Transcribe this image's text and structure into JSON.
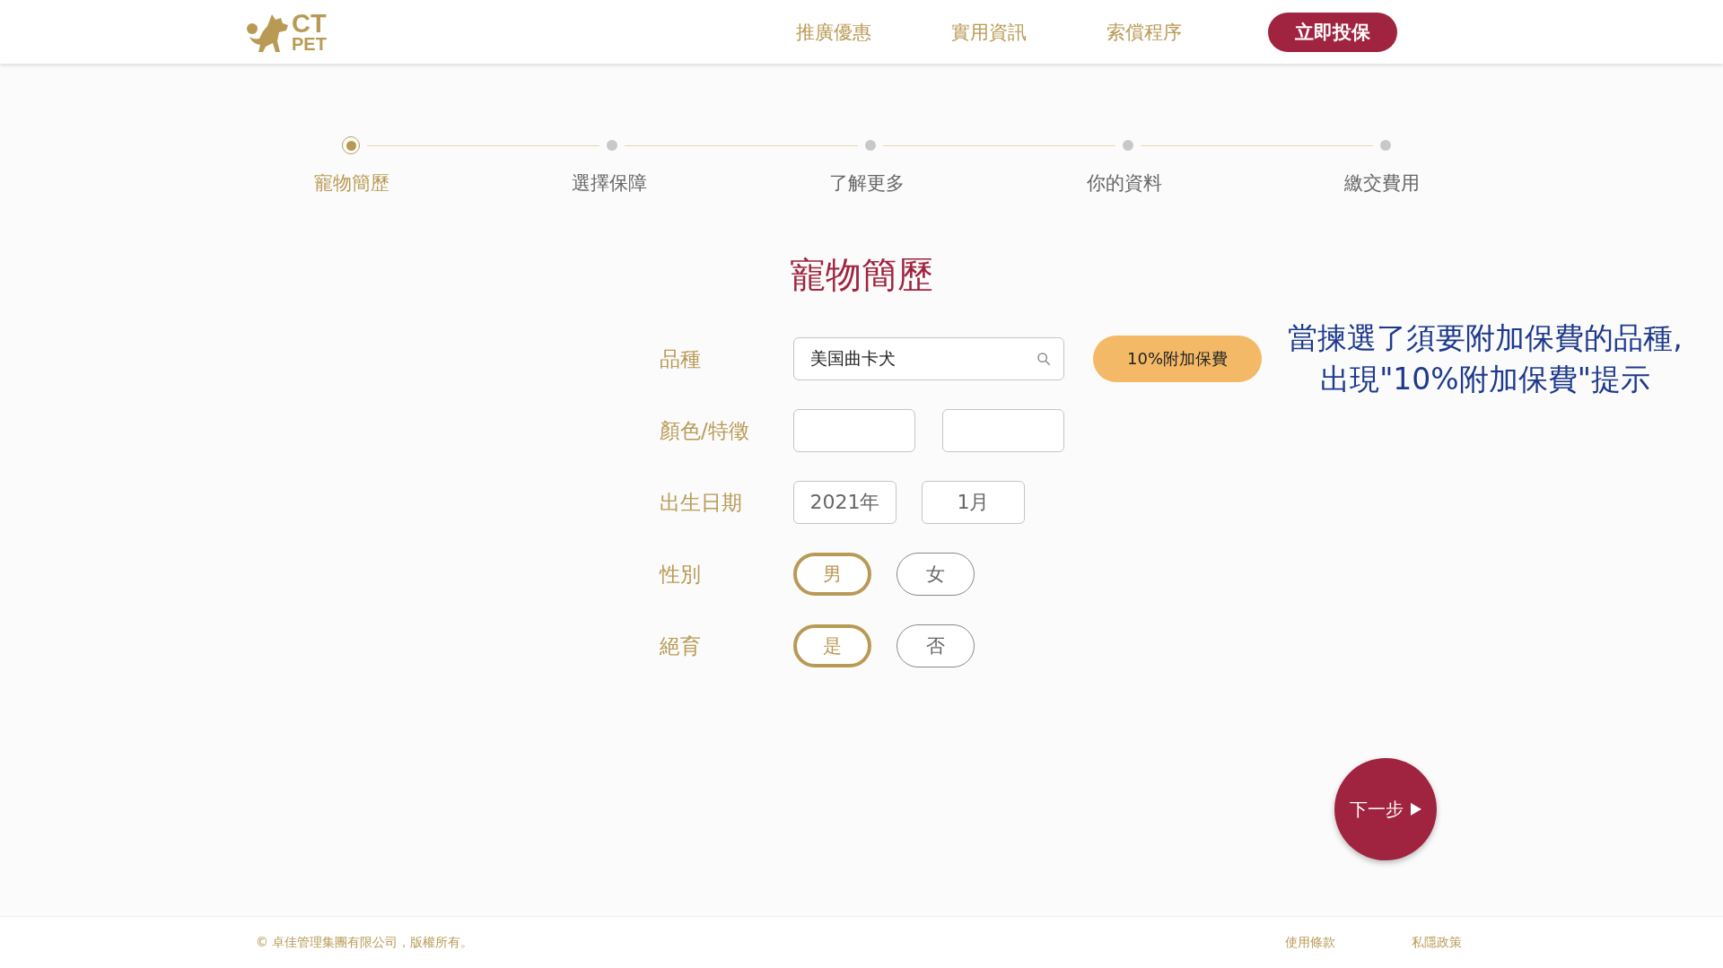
{
  "header": {
    "logo": {
      "line_1": "CT",
      "line_2": "PET"
    },
    "nav": [
      "推廣優惠",
      "實用資訊",
      "索償程序"
    ],
    "cta": "立即投保"
  },
  "steps": [
    {
      "label": "寵物簡歷",
      "selected": true
    },
    {
      "label": "選擇保障",
      "selected": false
    },
    {
      "label": "了解更多",
      "selected": false
    },
    {
      "label": "你的資料",
      "selected": false
    },
    {
      "label": "繳交費用",
      "selected": false
    }
  ],
  "title": "寵物簡歷",
  "form": [
    {
      "kind": "search",
      "label": "品種",
      "value": "美国曲卡犬",
      "badge": "10%附加保費",
      "note": "當揀選了須要附加保費的品種,\n出現\"10%附加保費\"提示"
    },
    {
      "kind": "input-pair",
      "label": "顏色/特徵"
    },
    {
      "kind": "selects",
      "label": "出生日期",
      "values": [
        "2021年",
        "1月"
      ]
    },
    {
      "kind": "options",
      "label": "性別",
      "options": [
        {
          "label": "男",
          "selected": true
        },
        {
          "label": "女",
          "selected": false
        }
      ]
    },
    {
      "kind": "options",
      "label": "絕育",
      "options": [
        {
          "label": "是",
          "selected": true
        },
        {
          "label": "否",
          "selected": false
        }
      ]
    }
  ],
  "next": "下一步",
  "footer": {
    "copyright": "© 卓佳管理集團有限公司，版權所有。",
    "links": [
      "使用條款",
      "私隱政策"
    ]
  }
}
